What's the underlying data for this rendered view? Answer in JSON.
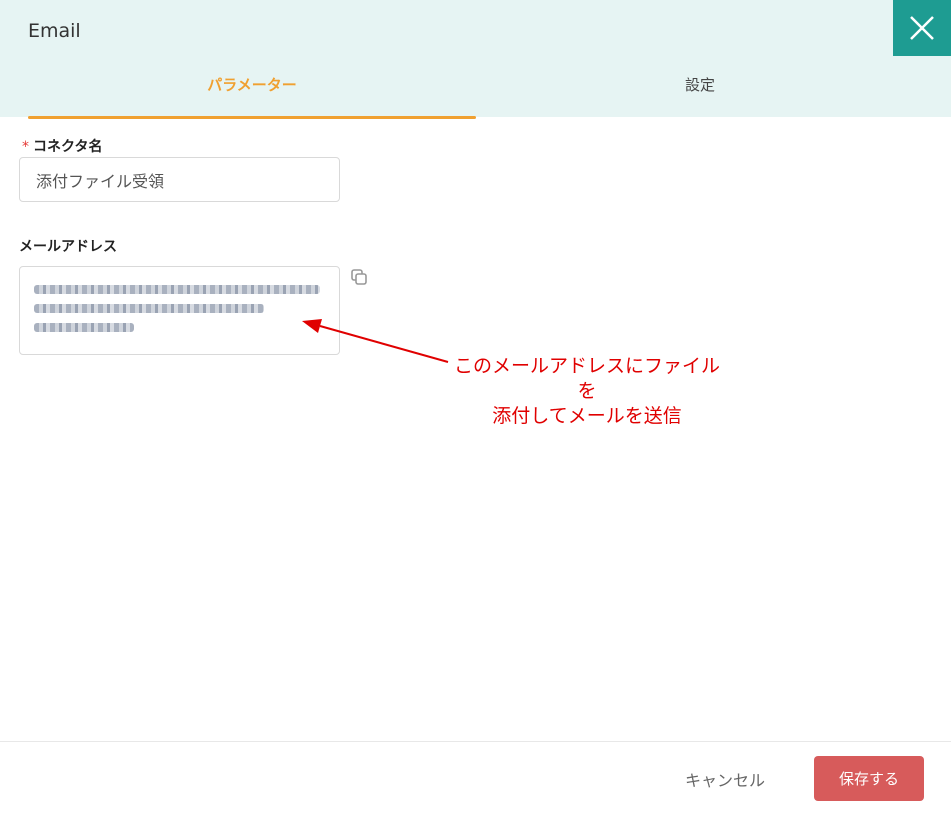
{
  "dialog": {
    "title": "Email",
    "close_icon": "close-icon"
  },
  "tabs": [
    {
      "label": "パラメーター",
      "active": true
    },
    {
      "label": "設定",
      "active": false
    }
  ],
  "form": {
    "connector_name": {
      "required_mark": "*",
      "label": "コネクタ名",
      "value": "添付ファイル受領"
    },
    "email_address": {
      "label": "メールアドレス",
      "copy_icon": "copy-icon"
    }
  },
  "annotation": {
    "line1": "このメールアドレスにファイルを",
    "line2": "添付してメールを送信"
  },
  "footer": {
    "cancel_label": "キャンセル",
    "save_label": "保存する"
  },
  "colors": {
    "header_bg": "#e6f4f3",
    "close_bg": "#1e9c92",
    "accent": "#f0a030",
    "save_bg": "#d75b5b",
    "annotation": "#e00000"
  }
}
